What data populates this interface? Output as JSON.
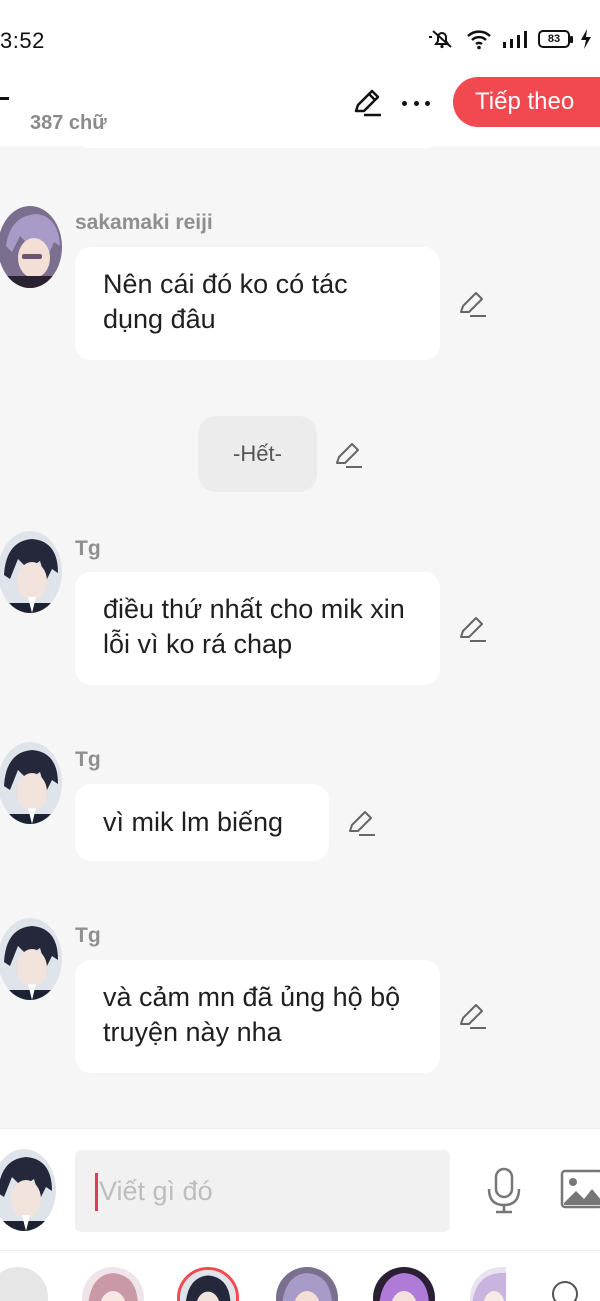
{
  "status_bar": {
    "time": "3:52",
    "battery": "83",
    "icons": [
      "mute-bell-icon",
      "wifi-icon",
      "signal-icon",
      "battery-icon",
      "charging-icon"
    ]
  },
  "header": {
    "word_count": "387 chữ",
    "next_label": "Tiếp theo",
    "icons": [
      "back-icon",
      "edit-icon",
      "more-icon"
    ],
    "accent_color": "#f2484f"
  },
  "messages": [
    {
      "sender": "sakamaki reiji",
      "text": "Nên cái đó ko có tác dụng đâu"
    },
    {
      "sender": "",
      "text": "-Hết-",
      "type": "narration"
    },
    {
      "sender": "Tg",
      "text": "điều thứ nhất cho mik xin lỗi vì ko rá chap"
    },
    {
      "sender": "Tg",
      "text": "vì mik lm biếng"
    },
    {
      "sender": "Tg",
      "text": "và cảm mn đã ủng hộ bộ truyện này nha"
    }
  ],
  "composer": {
    "placeholder": "Viết gì đó",
    "icons": [
      "microphone-icon",
      "image-icon"
    ]
  },
  "character_bar": {
    "icons": [
      "menu-icon",
      "search-icon"
    ],
    "selected_index": 1
  }
}
